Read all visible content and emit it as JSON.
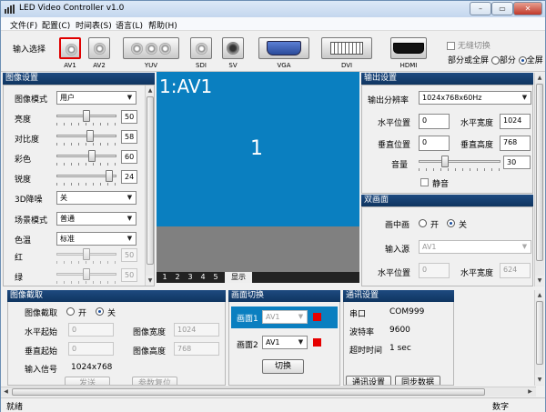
{
  "window": {
    "title": "LED Video Controller v1.0",
    "minimize": "–",
    "maximize": "▭",
    "close": "✕"
  },
  "menu": [
    "文件(F)",
    "配置(C)",
    "时间表(S)",
    "语言(L)",
    "帮助(H)"
  ],
  "input_bar": {
    "label": "输入选择",
    "sources": [
      {
        "label": "AV1",
        "selected": true
      },
      {
        "label": "AV2"
      },
      {
        "label": "YUV"
      },
      {
        "label": "SDI"
      },
      {
        "label": "SV"
      },
      {
        "label": "VGA"
      },
      {
        "label": "DVI"
      },
      {
        "label": "HDMI"
      }
    ],
    "seamless_label": "无缝切换",
    "partial_full_label": "部分或全屏",
    "partial_label": "部分",
    "full_label": "全屏"
  },
  "image_settings": {
    "title": "图像设置",
    "mode_label": "图像模式",
    "mode_value": "用户",
    "brightness_label": "亮度",
    "brightness": 50,
    "contrast_label": "对比度",
    "contrast": 58,
    "color_label": "彩色",
    "color": 60,
    "sharpness_label": "锐度",
    "sharpness": 24,
    "nr_label": "3D降噪",
    "nr_value": "关",
    "scene_label": "场景模式",
    "scene_value": "普通",
    "temp_label": "色温",
    "temp_value": "标准",
    "red_label": "红",
    "red": 50,
    "green_label": "绿",
    "green": 50
  },
  "preview": {
    "title": "1:AV1",
    "number": "1",
    "tabs": [
      "1",
      "2",
      "3",
      "4",
      "5"
    ],
    "tab_extra": "显示"
  },
  "output_settings": {
    "title": "输出设置",
    "resolution_label": "输出分辨率",
    "resolution": "1024x768x60Hz",
    "hpos_label": "水平位置",
    "hpos": "0",
    "hwidth_label": "水平宽度",
    "hwidth": "1024",
    "vpos_label": "垂直位置",
    "vpos": "0",
    "vheight_label": "垂直高度",
    "vheight": "768",
    "volume_label": "音量",
    "volume": "30",
    "mute_label": "静音"
  },
  "pip": {
    "title": "双画面",
    "pip_label": "画中画",
    "on_label": "开",
    "off_label": "关",
    "source_label": "输入源",
    "source_value": "AV1",
    "hpos_label": "水平位置",
    "hpos": "0",
    "hwidth_label": "水平宽度",
    "hwidth": "624"
  },
  "capture": {
    "title": "图像截取",
    "capture_label": "图像截取",
    "on_label": "开",
    "off_label": "关",
    "hstart_label": "水平起始",
    "hstart": "0",
    "width_label": "图像宽度",
    "width": "1024",
    "vstart_label": "垂直起始",
    "vstart": "0",
    "height_label": "图像高度",
    "height": "768",
    "signal_label": "输入信号",
    "signal": "1024x768",
    "send_button": "发送",
    "reset_button": "参数复位"
  },
  "switch": {
    "title": "画面切换",
    "screen1_label": "画面1",
    "screen1_value": "AV1",
    "screen2_label": "画面2",
    "screen2_value": "AV1",
    "switch_button": "切换"
  },
  "comm": {
    "title": "通讯设置",
    "port_label": "串口",
    "port": "COM999",
    "baud_label": "波特率",
    "baud": "9600",
    "timeout_label": "超时时间",
    "timeout": "1 sec",
    "comm_button": "通讯设置",
    "sync_button": "同步数据"
  },
  "status": {
    "left": "就绪",
    "right": "数字"
  }
}
